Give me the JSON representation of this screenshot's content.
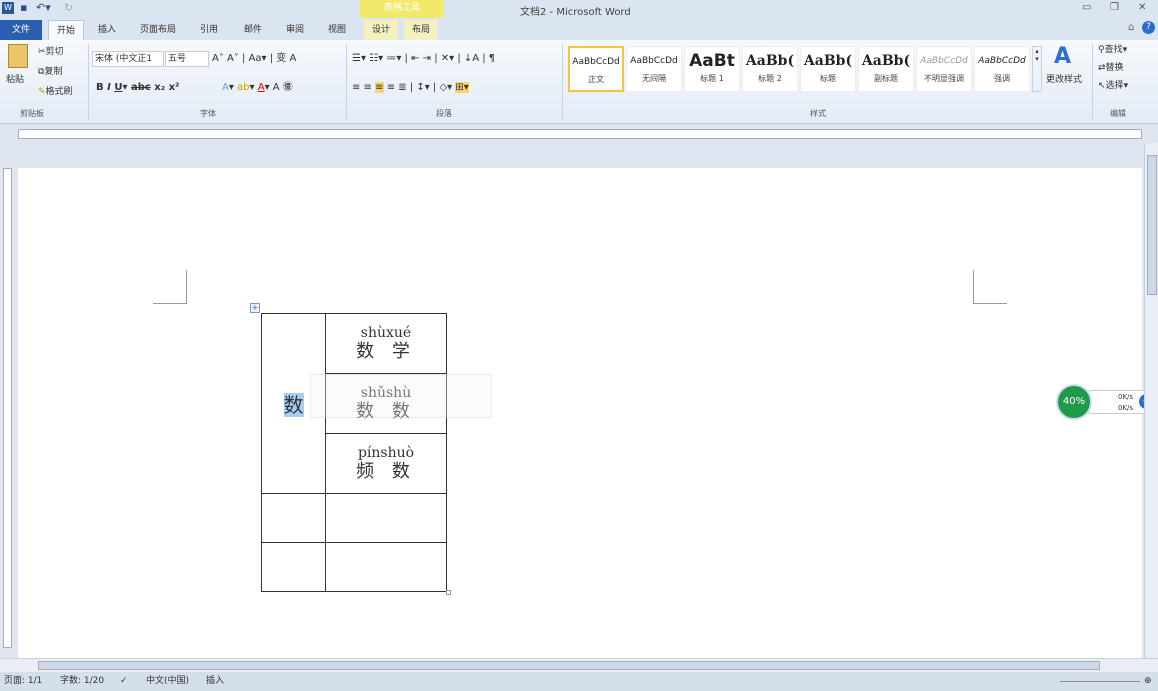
{
  "window": {
    "title": "文档2 - Microsoft Word",
    "context_tab_group": "表格工具"
  },
  "tabs": [
    {
      "label": "文件"
    },
    {
      "label": "开始"
    },
    {
      "label": "插入"
    },
    {
      "label": "页面布局"
    },
    {
      "label": "引用"
    },
    {
      "label": "邮件"
    },
    {
      "label": "审阅"
    },
    {
      "label": "视图"
    },
    {
      "label": "设计"
    },
    {
      "label": "布局"
    }
  ],
  "clipboard": {
    "paste": "粘贴",
    "cut": "剪切",
    "copy": "复制",
    "format_painter": "格式刷",
    "label": "剪贴板"
  },
  "font": {
    "name": "宋体 (中文正1",
    "size": "五号",
    "label": "字体"
  },
  "paragraph": {
    "label": "段落"
  },
  "styles": {
    "items": [
      {
        "preview": "AaBbCcDd",
        "name": "正文"
      },
      {
        "preview": "AaBbCcDd",
        "name": "无间隔"
      },
      {
        "preview": "AaBt",
        "name": "标题 1"
      },
      {
        "preview": "AaBb(",
        "name": "标题 2"
      },
      {
        "preview": "AaBb(",
        "name": "标题"
      },
      {
        "preview": "AaBb(",
        "name": "副标题"
      },
      {
        "preview": "AaBbCcDd",
        "name": "不明显强调"
      },
      {
        "preview": "AaBbCcDd",
        "name": "强调"
      }
    ],
    "change": "更改样式",
    "label": "样式"
  },
  "editing": {
    "find": "查找",
    "replace": "替换",
    "select": "选择",
    "label": "编辑"
  },
  "document": {
    "merged_cell": "数",
    "rows": [
      {
        "pinyin": "shùxué",
        "hanzi": "数 学"
      },
      {
        "pinyin": "shǔshù",
        "hanzi": "数 数"
      },
      {
        "pinyin": "pínshuò",
        "hanzi": "频 数"
      }
    ]
  },
  "widget": {
    "percent": "40%",
    "up": "0K/s",
    "down": "0K/s"
  },
  "status": {
    "page": "页面: 1/1",
    "words": "字数: 1/20",
    "language": "中文(中国)",
    "mode": "插入"
  }
}
